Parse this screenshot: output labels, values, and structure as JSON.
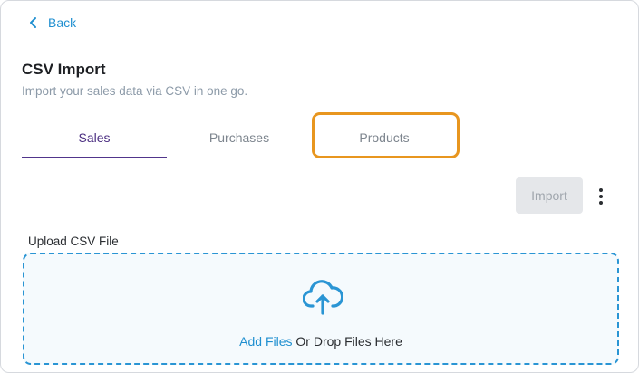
{
  "nav": {
    "back_label": "Back"
  },
  "header": {
    "title": "CSV Import",
    "subtitle": "Import your sales data via CSV in one go."
  },
  "tabs": [
    {
      "label": "Sales",
      "active": true
    },
    {
      "label": "Purchases",
      "active": false
    },
    {
      "label": "Products",
      "active": false,
      "highlighted": true
    }
  ],
  "toolbar": {
    "import_label": "Import",
    "import_disabled": true,
    "more_icon": "more-vertical-icon"
  },
  "upload": {
    "label": "Upload CSV File",
    "add_files_label": "Add Files",
    "drop_label": "Or Drop Files Here",
    "icon": "cloud-upload-icon"
  },
  "colors": {
    "accent_blue": "#1f8fd0",
    "active_tab": "#51358b",
    "highlight_orange": "#e8961f",
    "dropzone_border": "#2a95d4"
  }
}
